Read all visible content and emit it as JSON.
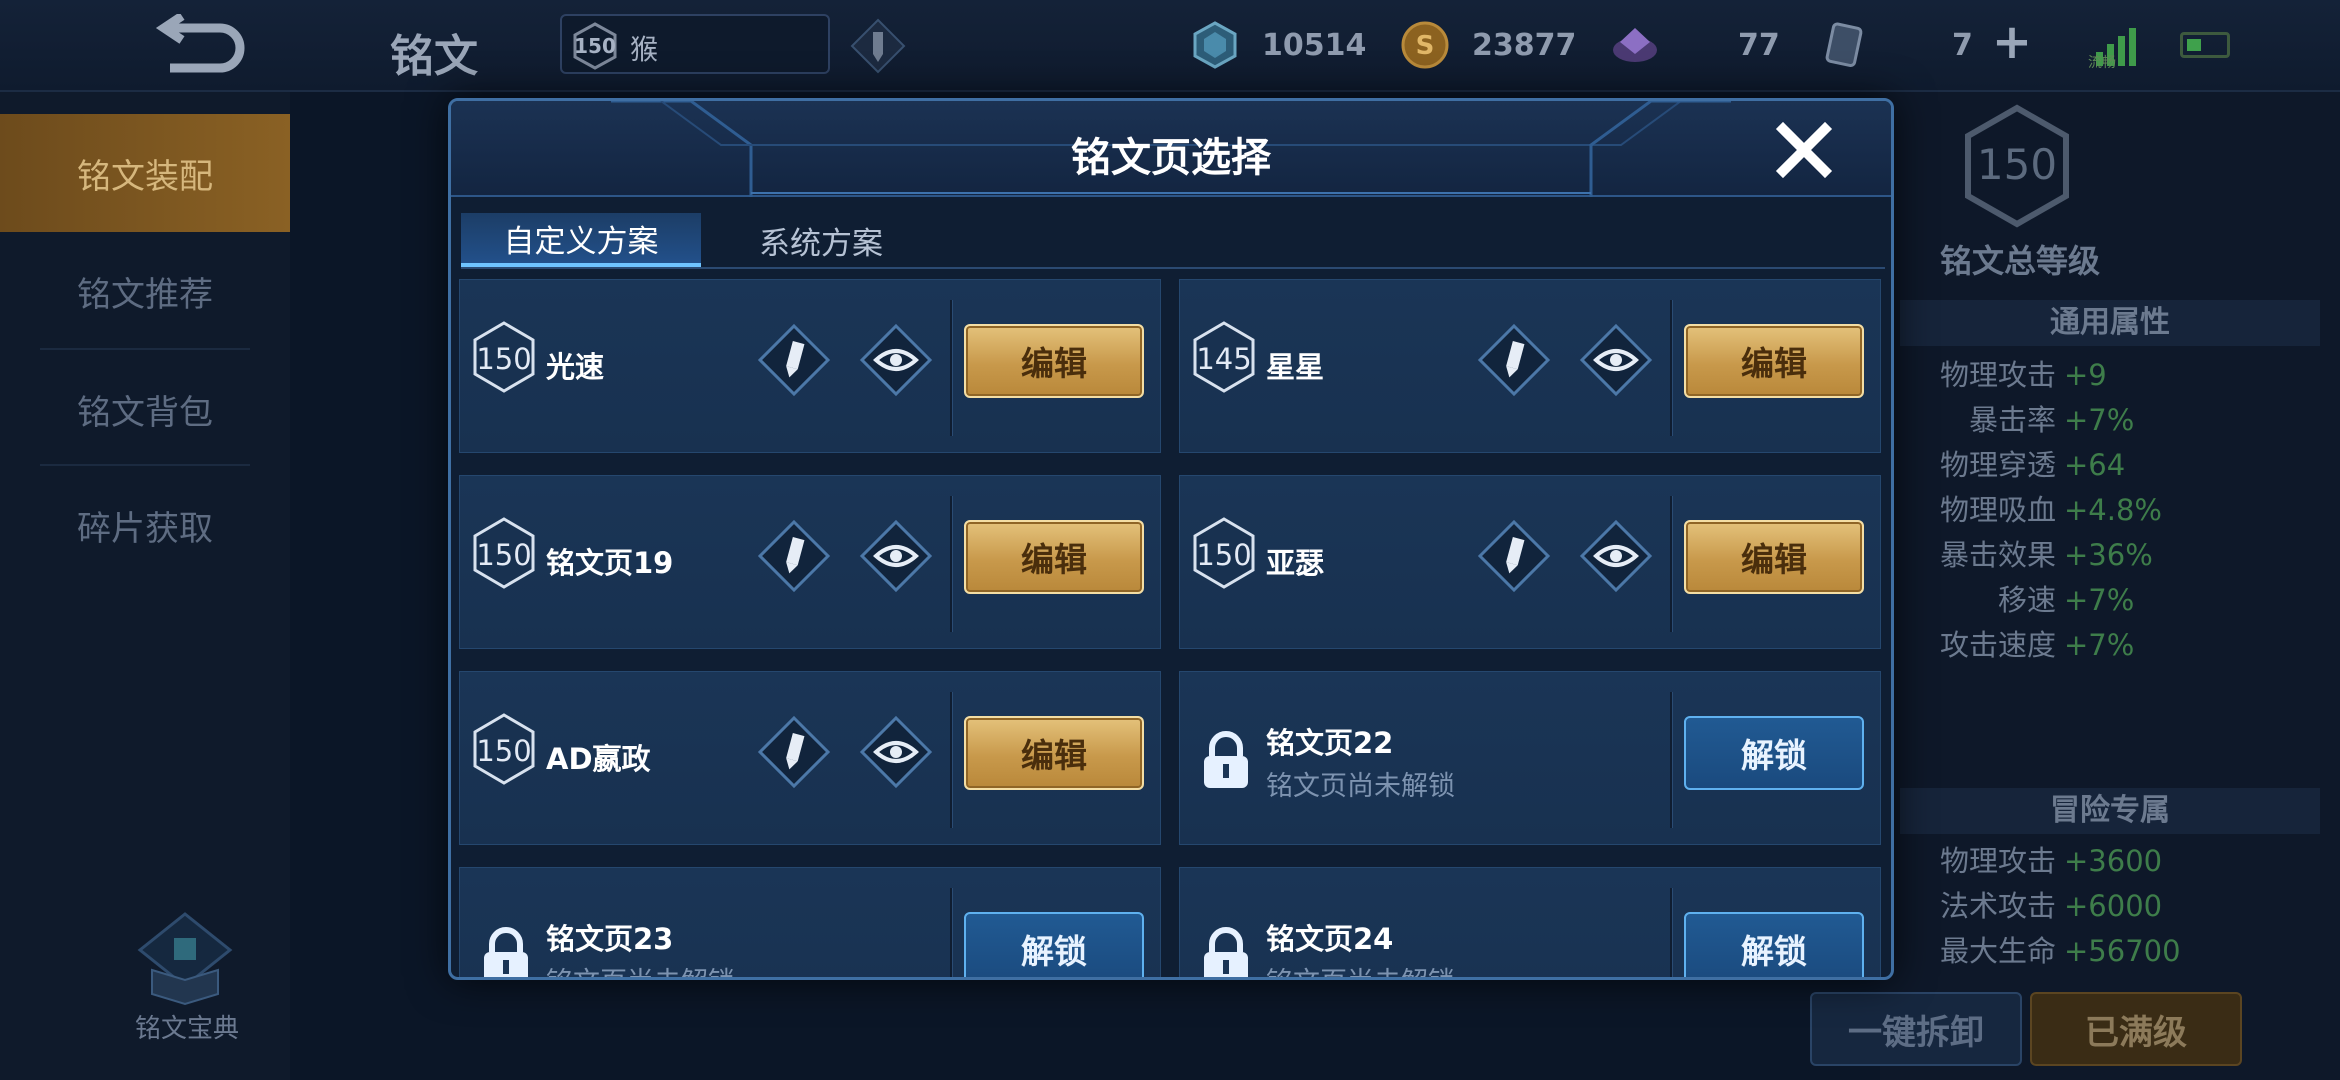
{
  "topbar": {
    "title": "铭文",
    "hero_level": "150",
    "hero_name": "猴",
    "currencies": [
      {
        "icon": "crystal-icon",
        "value": "10514"
      },
      {
        "icon": "gold-coin-icon",
        "value": "23877"
      },
      {
        "icon": "gem-icon",
        "value": "77"
      },
      {
        "icon": "card-icon",
        "value": "7"
      }
    ],
    "signal_label": "流畅"
  },
  "sidebar": {
    "items": [
      {
        "label": "铭文装配",
        "active": true
      },
      {
        "label": "铭文推荐",
        "active": false
      },
      {
        "label": "铭文背包",
        "active": false
      },
      {
        "label": "碎片获取",
        "active": false
      }
    ],
    "codex_label": "铭文宝典"
  },
  "stats": {
    "total_level": "150",
    "total_level_label": "铭文总等级",
    "general_title": "通用属性",
    "general": [
      {
        "k": "物理攻击",
        "v": "+9"
      },
      {
        "k": "暴击率",
        "v": "+7%"
      },
      {
        "k": "物理穿透",
        "v": "+64"
      },
      {
        "k": "物理吸血",
        "v": "+4.8%"
      },
      {
        "k": "暴击效果",
        "v": "+36%"
      },
      {
        "k": "移速",
        "v": "+7%"
      },
      {
        "k": "攻击速度",
        "v": "+7%"
      }
    ],
    "adventure_title": "冒险专属",
    "adventure": [
      {
        "k": "物理攻击",
        "v": "+3600"
      },
      {
        "k": "法术攻击",
        "v": "+6000"
      },
      {
        "k": "最大生命",
        "v": "+56700"
      }
    ],
    "unload_label": "一键拆卸",
    "maxed_label": "已满级"
  },
  "modal": {
    "title": "铭文页选择",
    "tabs": [
      "自定义方案",
      "系统方案"
    ],
    "pages": [
      {
        "level": "150",
        "name": "光速",
        "action": "编辑"
      },
      {
        "level": "145",
        "name": "星星",
        "action": "编辑"
      },
      {
        "level": "150",
        "name": "铭文页19",
        "action": "编辑"
      },
      {
        "level": "150",
        "name": "亚瑟",
        "action": "编辑"
      },
      {
        "level": "150",
        "name": "AD嬴政",
        "action": "编辑"
      }
    ],
    "locked": [
      {
        "name": "铭文页22",
        "status": "铭文页尚未解锁",
        "action": "解锁"
      },
      {
        "name": "铭文页23",
        "status": "铭文页尚未解锁",
        "action": "解锁"
      },
      {
        "name": "铭文页24",
        "status": "铭文页尚未解锁",
        "action": "解锁"
      }
    ]
  },
  "colors": {
    "accent_gold": "#c8994b",
    "accent_blue": "#5fb1ef",
    "stat_green": "#3e7d4a"
  }
}
